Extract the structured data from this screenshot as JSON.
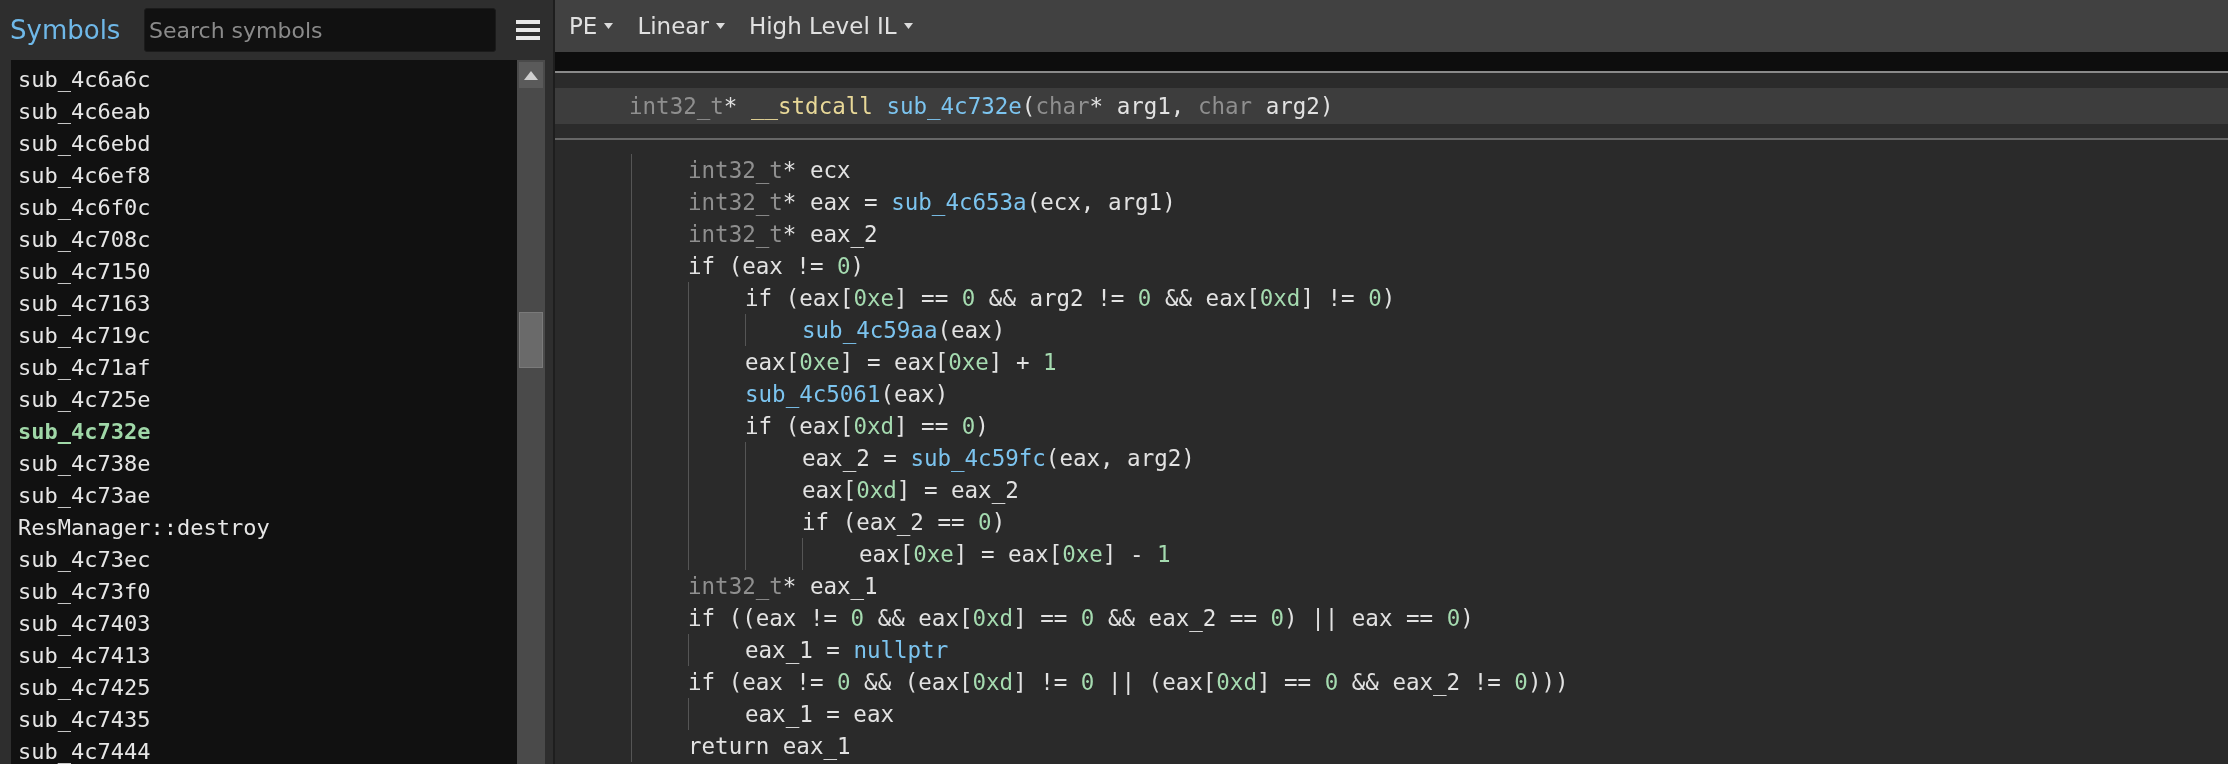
{
  "sidebar": {
    "title": "Symbols",
    "search": {
      "placeholder": "Search symbols"
    },
    "items": [
      {
        "label": "sub_4c6a6c",
        "selected": false
      },
      {
        "label": "sub_4c6eab",
        "selected": false
      },
      {
        "label": "sub_4c6ebd",
        "selected": false
      },
      {
        "label": "sub_4c6ef8",
        "selected": false
      },
      {
        "label": "sub_4c6f0c",
        "selected": false
      },
      {
        "label": "sub_4c708c",
        "selected": false
      },
      {
        "label": "sub_4c7150",
        "selected": false
      },
      {
        "label": "sub_4c7163",
        "selected": false
      },
      {
        "label": "sub_4c719c",
        "selected": false
      },
      {
        "label": "sub_4c71af",
        "selected": false
      },
      {
        "label": "sub_4c725e",
        "selected": false
      },
      {
        "label": "sub_4c732e",
        "selected": true
      },
      {
        "label": "sub_4c738e",
        "selected": false
      },
      {
        "label": "sub_4c73ae",
        "selected": false
      },
      {
        "label": "ResManager::destroy",
        "selected": false
      },
      {
        "label": "sub_4c73ec",
        "selected": false
      },
      {
        "label": "sub_4c73f0",
        "selected": false
      },
      {
        "label": "sub_4c7403",
        "selected": false
      },
      {
        "label": "sub_4c7413",
        "selected": false
      },
      {
        "label": "sub_4c7425",
        "selected": false
      },
      {
        "label": "sub_4c7435",
        "selected": false
      },
      {
        "label": "sub_4c7444",
        "selected": false
      }
    ]
  },
  "toolbar": [
    {
      "label": "PE"
    },
    {
      "label": "Linear"
    },
    {
      "label": "High Level IL"
    }
  ],
  "function": {
    "signature": [
      {
        "kind": "type",
        "text": "int32_t"
      },
      {
        "kind": "plain",
        "text": "* "
      },
      {
        "kind": "keyword",
        "text": "__stdcall "
      },
      {
        "kind": "func",
        "text": "sub_4c732e"
      },
      {
        "kind": "plain",
        "text": "("
      },
      {
        "kind": "type",
        "text": "char"
      },
      {
        "kind": "plain",
        "text": "* arg1, "
      },
      {
        "kind": "type",
        "text": "char"
      },
      {
        "kind": "plain",
        "text": " arg2)"
      }
    ],
    "body": [
      {
        "tokens": [
          {
            "kind": "type",
            "text": "int32_t"
          },
          {
            "kind": "plain",
            "text": "* ecx"
          }
        ]
      },
      {
        "tokens": [
          {
            "kind": "type",
            "text": "int32_t"
          },
          {
            "kind": "plain",
            "text": "* eax = "
          },
          {
            "kind": "func",
            "text": "sub_4c653a"
          },
          {
            "kind": "plain",
            "text": "(ecx, arg1)"
          }
        ]
      },
      {
        "tokens": [
          {
            "kind": "type",
            "text": "int32_t"
          },
          {
            "kind": "plain",
            "text": "* eax_2"
          }
        ]
      },
      {
        "tokens": [
          {
            "kind": "plain",
            "text": "if (eax != "
          },
          {
            "kind": "num",
            "text": "0"
          },
          {
            "kind": "plain",
            "text": ")"
          }
        ],
        "children": [
          {
            "tokens": [
              {
                "kind": "plain",
                "text": "if (eax["
              },
              {
                "kind": "num",
                "text": "0xe"
              },
              {
                "kind": "plain",
                "text": "] == "
              },
              {
                "kind": "num",
                "text": "0"
              },
              {
                "kind": "plain",
                "text": " && arg2 != "
              },
              {
                "kind": "num",
                "text": "0"
              },
              {
                "kind": "plain",
                "text": " && eax["
              },
              {
                "kind": "num",
                "text": "0xd"
              },
              {
                "kind": "plain",
                "text": "] != "
              },
              {
                "kind": "num",
                "text": "0"
              },
              {
                "kind": "plain",
                "text": ")"
              }
            ],
            "children": [
              {
                "tokens": [
                  {
                    "kind": "func",
                    "text": "sub_4c59aa"
                  },
                  {
                    "kind": "plain",
                    "text": "(eax)"
                  }
                ]
              }
            ]
          },
          {
            "tokens": [
              {
                "kind": "plain",
                "text": "eax["
              },
              {
                "kind": "num",
                "text": "0xe"
              },
              {
                "kind": "plain",
                "text": "] = eax["
              },
              {
                "kind": "num",
                "text": "0xe"
              },
              {
                "kind": "plain",
                "text": "] + "
              },
              {
                "kind": "num",
                "text": "1"
              }
            ]
          },
          {
            "tokens": [
              {
                "kind": "func",
                "text": "sub_4c5061"
              },
              {
                "kind": "plain",
                "text": "(eax)"
              }
            ]
          },
          {
            "tokens": [
              {
                "kind": "plain",
                "text": "if (eax["
              },
              {
                "kind": "num",
                "text": "0xd"
              },
              {
                "kind": "plain",
                "text": "] == "
              },
              {
                "kind": "num",
                "text": "0"
              },
              {
                "kind": "plain",
                "text": ")"
              }
            ],
            "children": [
              {
                "tokens": [
                  {
                    "kind": "plain",
                    "text": "eax_2 = "
                  },
                  {
                    "kind": "func",
                    "text": "sub_4c59fc"
                  },
                  {
                    "kind": "plain",
                    "text": "(eax, arg2)"
                  }
                ]
              },
              {
                "tokens": [
                  {
                    "kind": "plain",
                    "text": "eax["
                  },
                  {
                    "kind": "num",
                    "text": "0xd"
                  },
                  {
                    "kind": "plain",
                    "text": "] = eax_2"
                  }
                ]
              },
              {
                "tokens": [
                  {
                    "kind": "plain",
                    "text": "if (eax_2 == "
                  },
                  {
                    "kind": "num",
                    "text": "0"
                  },
                  {
                    "kind": "plain",
                    "text": ")"
                  }
                ],
                "children": [
                  {
                    "tokens": [
                      {
                        "kind": "plain",
                        "text": "eax["
                      },
                      {
                        "kind": "num",
                        "text": "0xe"
                      },
                      {
                        "kind": "plain",
                        "text": "] = eax["
                      },
                      {
                        "kind": "num",
                        "text": "0xe"
                      },
                      {
                        "kind": "plain",
                        "text": "] - "
                      },
                      {
                        "kind": "num",
                        "text": "1"
                      }
                    ]
                  }
                ]
              }
            ]
          }
        ]
      },
      {
        "tokens": [
          {
            "kind": "type",
            "text": "int32_t"
          },
          {
            "kind": "plain",
            "text": "* eax_1"
          }
        ]
      },
      {
        "tokens": [
          {
            "kind": "plain",
            "text": "if ((eax != "
          },
          {
            "kind": "num",
            "text": "0"
          },
          {
            "kind": "plain",
            "text": " && eax["
          },
          {
            "kind": "num",
            "text": "0xd"
          },
          {
            "kind": "plain",
            "text": "] == "
          },
          {
            "kind": "num",
            "text": "0"
          },
          {
            "kind": "plain",
            "text": " && eax_2 == "
          },
          {
            "kind": "num",
            "text": "0"
          },
          {
            "kind": "plain",
            "text": ") || eax == "
          },
          {
            "kind": "num",
            "text": "0"
          },
          {
            "kind": "plain",
            "text": ")"
          }
        ],
        "children": [
          {
            "tokens": [
              {
                "kind": "plain",
                "text": "eax_1 = "
              },
              {
                "kind": "const",
                "text": "nullptr"
              }
            ]
          }
        ]
      },
      {
        "tokens": [
          {
            "kind": "plain",
            "text": "if (eax != "
          },
          {
            "kind": "num",
            "text": "0"
          },
          {
            "kind": "plain",
            "text": " && (eax["
          },
          {
            "kind": "num",
            "text": "0xd"
          },
          {
            "kind": "plain",
            "text": "] != "
          },
          {
            "kind": "num",
            "text": "0"
          },
          {
            "kind": "plain",
            "text": " || (eax["
          },
          {
            "kind": "num",
            "text": "0xd"
          },
          {
            "kind": "plain",
            "text": "] == "
          },
          {
            "kind": "num",
            "text": "0"
          },
          {
            "kind": "plain",
            "text": " && eax_2 != "
          },
          {
            "kind": "num",
            "text": "0"
          },
          {
            "kind": "plain",
            "text": ")))"
          }
        ],
        "children": [
          {
            "tokens": [
              {
                "kind": "plain",
                "text": "eax_1 = eax"
              }
            ]
          }
        ]
      },
      {
        "tokens": [
          {
            "kind": "plain",
            "text": "return eax_1"
          }
        ]
      }
    ]
  }
}
